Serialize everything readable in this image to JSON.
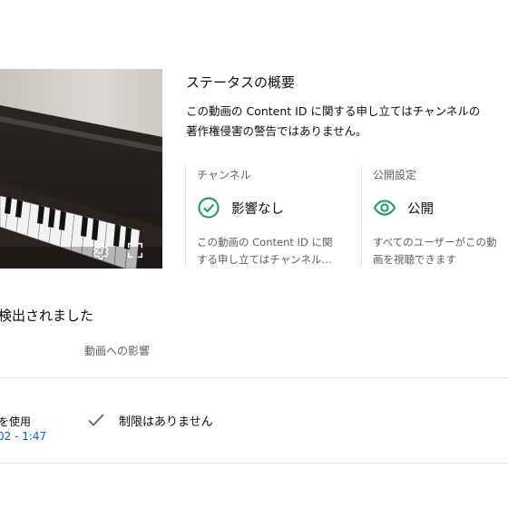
{
  "video": {
    "thumbnail_desc": "piano",
    "settings_icon": "gear-icon",
    "fullscreen_icon": "fullscreen-icon"
  },
  "status": {
    "title": "ステータスの概要",
    "description_line1": "この動画の Content ID に関する申し立てはチャンネルの",
    "description_line2": "著作権侵害の警告ではありません。"
  },
  "channel_card": {
    "label": "チャンネル",
    "value": "影響なし",
    "icon": "check-circle-icon",
    "note_line1": "この動画の Content ID に関",
    "note_line2": "する申し立てはチャンネル…",
    "accent_color": "#0f9d58"
  },
  "visibility_card": {
    "label": "公開設定",
    "value": "公開",
    "icon": "eye-icon",
    "note_line1": "すべてのユーザーがこの動",
    "note_line2": "画を視聴できます",
    "accent_color": "#0f9d58"
  },
  "claims": {
    "heading": "検出されました",
    "column_effect": "動画への影響",
    "row": {
      "usage": "を使用",
      "timestamp": "02 - 1:47",
      "effect": "制限はありません",
      "effect_icon": "checkmark-icon"
    }
  }
}
